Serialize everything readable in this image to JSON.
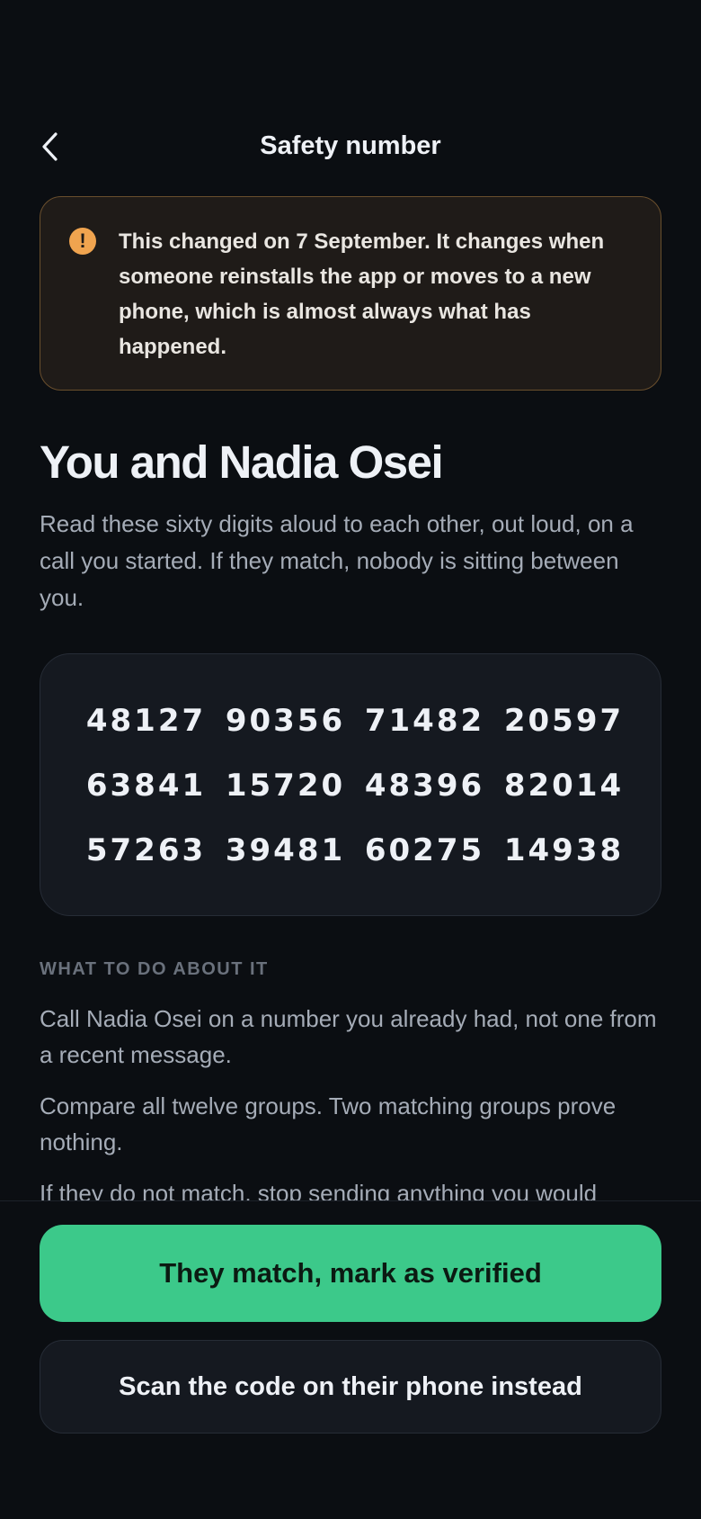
{
  "header": {
    "title": "Safety number",
    "back_icon": "chevron-left-icon"
  },
  "warning": {
    "icon": "exclamation-circle-icon",
    "icon_glyph": "!",
    "text": "This changed on 7 September. It changes when someone reinstalls the app or moves to a new phone, which is almost always what has happened.",
    "accent_color": "#f0a44f"
  },
  "contact": {
    "heading": "You and Nadia Osei",
    "lead": "Read these sixty digits aloud to each other, out loud, on a call you started. If they match, nobody is sitting between you."
  },
  "safety_number": {
    "groups": [
      "48127",
      "90356",
      "71482",
      "20597",
      "63841",
      "15720",
      "48396",
      "82014",
      "57263",
      "39481",
      "60275",
      "14938"
    ]
  },
  "guidance": {
    "label": "WHAT TO DO ABOUT IT",
    "steps": [
      "Call Nadia Osei on a number you already had, not one from a recent message.",
      "Compare all twelve groups. Two matching groups prove nothing.",
      "If they do not match, stop sending anything you would"
    ]
  },
  "actions": {
    "primary_label": "They match, mark as verified",
    "secondary_label": "Scan the code on their phone instead",
    "primary_color": "#3cc98a"
  }
}
